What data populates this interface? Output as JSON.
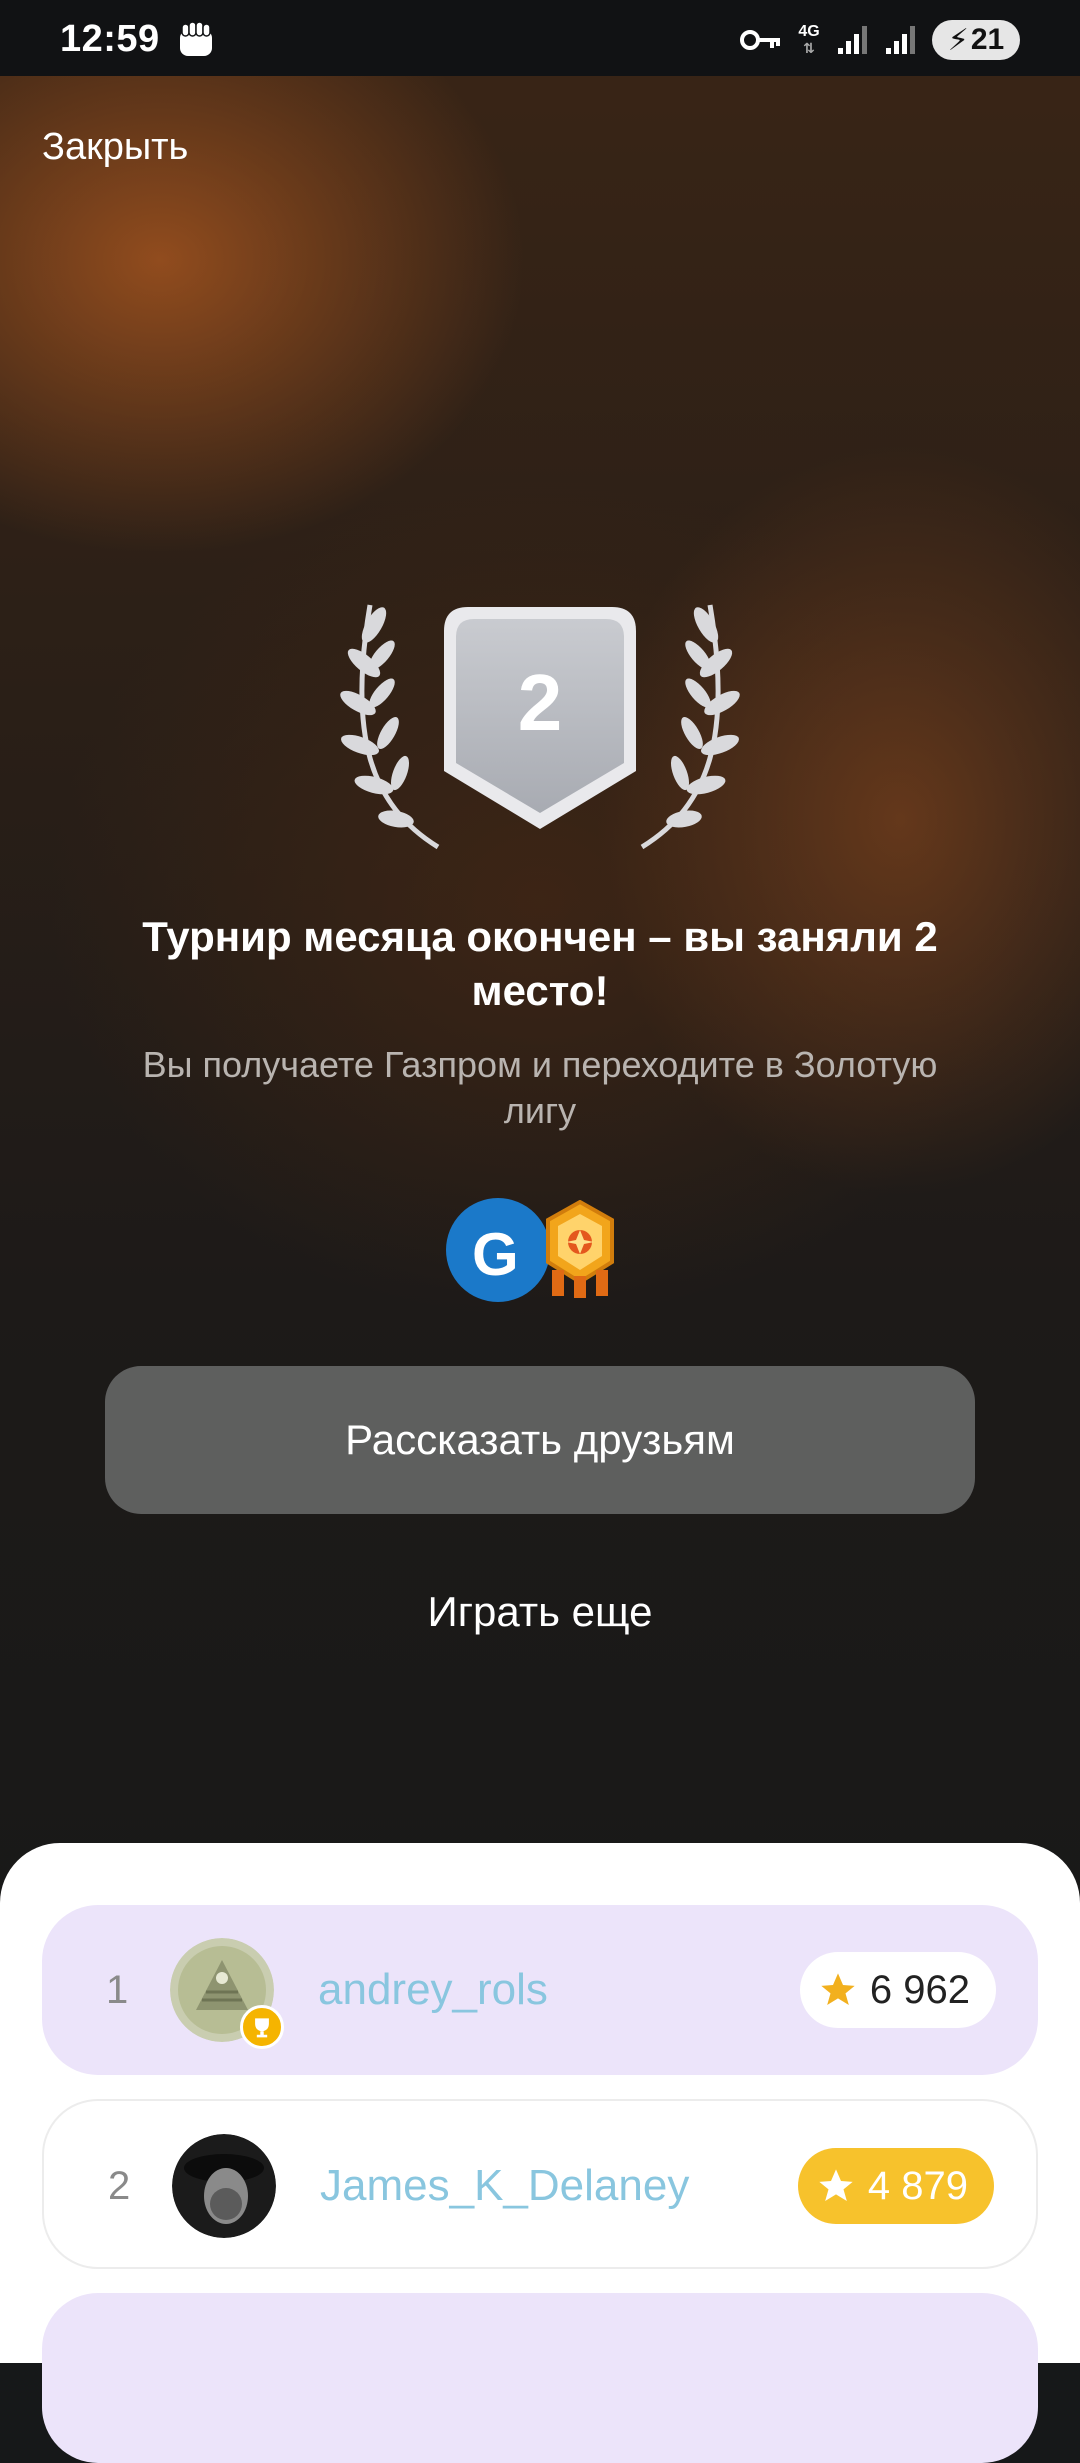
{
  "status_bar": {
    "time": "12:59",
    "network": "4G",
    "battery": "21"
  },
  "header": {
    "close_label": "Закрыть"
  },
  "result": {
    "place": "2",
    "title": "Турнир месяца окончен – вы заняли 2 место!",
    "subtitle": "Вы получаете Газпром и переходите в Золотую лигу",
    "rewards": [
      "gazprom-logo",
      "gold-league-badge"
    ]
  },
  "actions": {
    "share_label": "Рассказать друзьям",
    "play_again_label": "Играть еще"
  },
  "leaderboard": [
    {
      "rank": "1",
      "name": "andrey_rols",
      "score": "6 962"
    },
    {
      "rank": "2",
      "name": "James_K_Delaney",
      "score": "4 879"
    }
  ],
  "colors": {
    "accent_username": "#89c6df",
    "highlight_row": "#ece4fa",
    "gold": "#f7c22c",
    "share_button": "#5e5f5e"
  }
}
